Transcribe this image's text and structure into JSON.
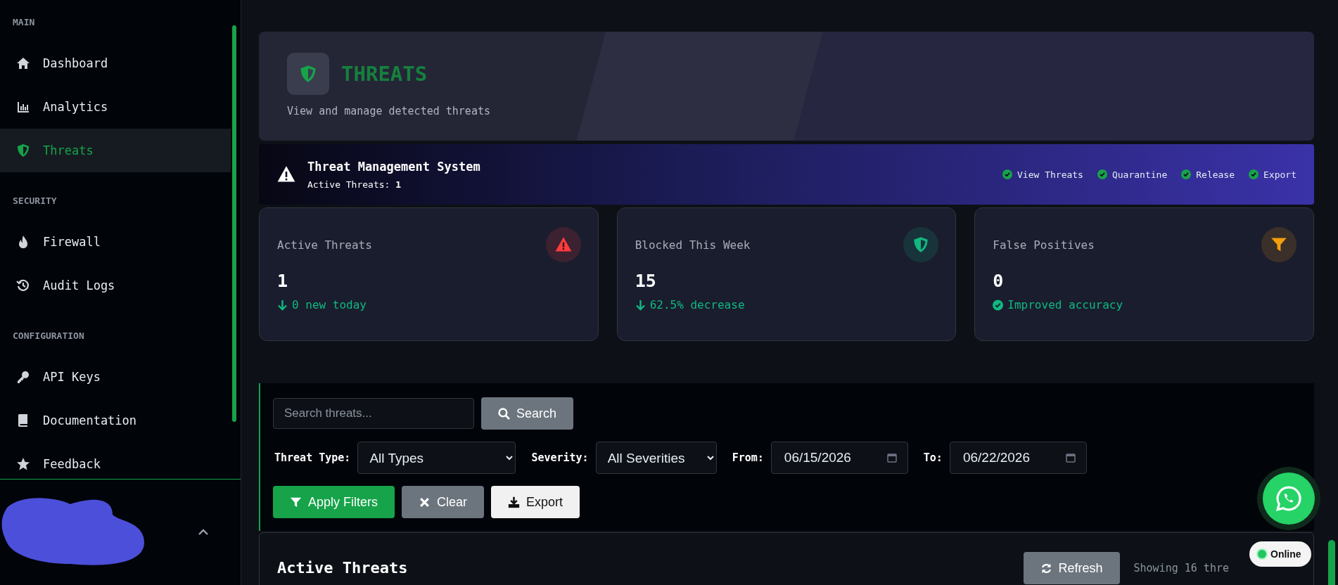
{
  "sidebar": {
    "sections": [
      {
        "title": "MAIN",
        "items": [
          {
            "label": "Dashboard",
            "selected": false
          },
          {
            "label": "Analytics",
            "selected": false
          },
          {
            "label": "Threats",
            "selected": true
          }
        ]
      },
      {
        "title": "SECURITY",
        "items": [
          {
            "label": "Firewall",
            "selected": false
          },
          {
            "label": "Audit Logs",
            "selected": false
          }
        ]
      },
      {
        "title": "CONFIGURATION",
        "items": [
          {
            "label": "API Keys",
            "selected": false
          },
          {
            "label": "Documentation",
            "selected": false
          },
          {
            "label": "Feedback",
            "selected": false
          }
        ]
      }
    ]
  },
  "header": {
    "title": "THREATS",
    "subtitle": "View and manage detected threats"
  },
  "banner": {
    "title": "Threat Management System",
    "active_label": "Active Threats:",
    "active_value": "1",
    "permissions": [
      "View Threats",
      "Quarantine",
      "Release",
      "Export"
    ]
  },
  "stats": [
    {
      "label": "Active Threats",
      "value": "1",
      "trend": "0 new today",
      "color": "#ff3b3b"
    },
    {
      "label": "Blocked This Week",
      "value": "15",
      "trend": "62.5% decrease",
      "color": "#10b981"
    },
    {
      "label": "False Positives",
      "value": "0",
      "trend": "Improved accuracy",
      "color": "#f59e0b"
    }
  ],
  "filters": {
    "search_placeholder": "Search threats...",
    "search_button": "Search",
    "fields": [
      {
        "label": "Threat Type:",
        "kind": "select",
        "value": "All Types"
      },
      {
        "label": "Severity:",
        "kind": "select",
        "value": "All Severities"
      },
      {
        "label": "From:",
        "kind": "date",
        "value": "06/15/2026"
      },
      {
        "label": "To:",
        "kind": "date",
        "value": "06/22/2026"
      }
    ],
    "buttons": [
      {
        "label": "Apply Filters",
        "kind": "apply"
      },
      {
        "label": "Clear",
        "kind": "clear"
      },
      {
        "label": "Export",
        "kind": "export"
      }
    ]
  },
  "threats_panel": {
    "title": "Active Threats",
    "refresh_button": "Refresh",
    "showing": "Showing 16 thre"
  },
  "chat_widget": {
    "status": "Online"
  }
}
